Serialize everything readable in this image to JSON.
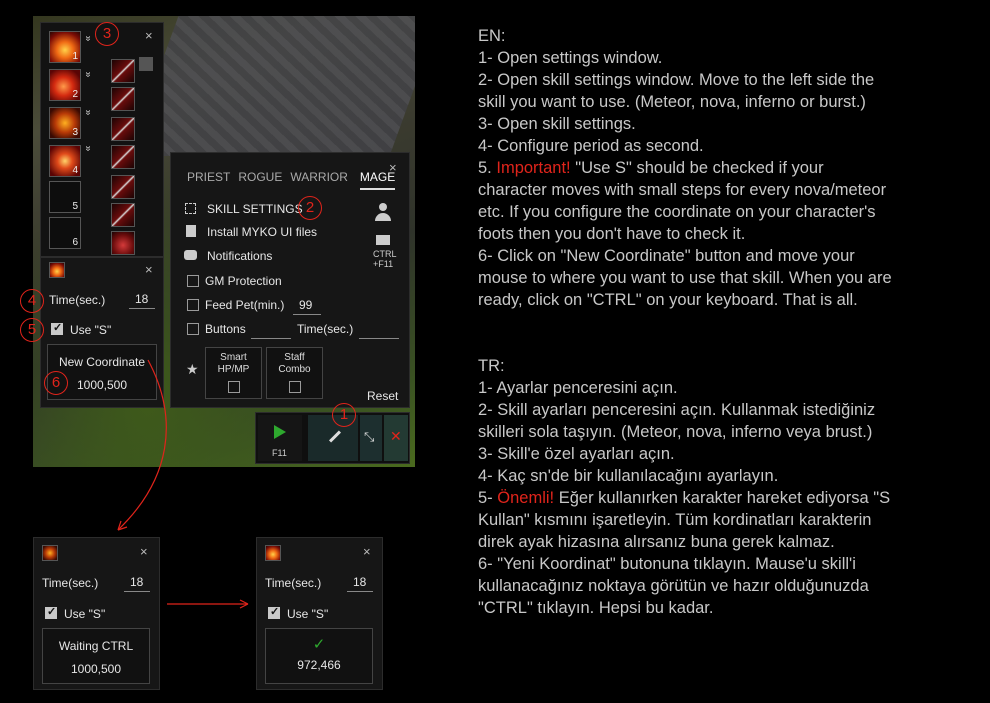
{
  "skillbar": {
    "close_label": "×",
    "slots": [
      {
        "num": "1",
        "icon": "fire-skill-icon"
      },
      {
        "num": "2",
        "icon": "fire-skill-icon"
      },
      {
        "num": "3",
        "icon": "skull-fire-icon"
      },
      {
        "num": "4",
        "icon": "fire-ring-icon"
      },
      {
        "num": "5",
        "icon": ""
      },
      {
        "num": "6",
        "icon": ""
      }
    ],
    "chevron": "»"
  },
  "skill_panel": {
    "close_label": "×",
    "time_label": "Time(sec.)",
    "time_value": "18",
    "use_s_label": "Use \"S\"",
    "coord_button": "New Coordinate",
    "coord_value": "1000,500"
  },
  "settings": {
    "close_label": "×",
    "tabs": [
      "PRIEST",
      "ROGUE",
      "WARRIOR",
      "MAGE"
    ],
    "active_tab": "MAGE",
    "skill_settings": "SKILL SETTINGS",
    "install_ui": "Install MYKO UI files",
    "notifications": "Notifications",
    "gm_protection": "GM Protection",
    "feed_pet": "Feed Pet(min.)",
    "feed_pet_value": "99",
    "buttons": "Buttons",
    "time_sec": "Time(sec.)",
    "ctrl_label": "CTRL",
    "ctrl_key": "+F11",
    "smart": "Smart HP/MP",
    "staff": "Staff Combo",
    "reset": "Reset"
  },
  "toolbar": {
    "play_key": "F11"
  },
  "markers": [
    "1",
    "2",
    "3",
    "4",
    "5",
    "6"
  ],
  "waiting_panel": {
    "close_label": "×",
    "time_label": "Time(sec.)",
    "time_value": "18",
    "use_s_label": "Use \"S\"",
    "button_label": "Waiting CTRL",
    "coord_value": "1000,500"
  },
  "done_panel": {
    "close_label": "×",
    "time_label": "Time(sec.)",
    "time_value": "18",
    "use_s_label": "Use \"S\"",
    "check_mark": "✓",
    "coord_value": "972,466"
  },
  "instructions_en": {
    "heading": "EN:",
    "lines": [
      "1- Open settings window.",
      "2- Open skill settings window. Move to the left side the",
      "skill you want to use. (Meteor, nova, inferno or burst.)",
      "3- Open skill settings.",
      "4- Configure period as second."
    ],
    "important_prefix": "5. ",
    "important_word": "Important!",
    "important_rest": " \"Use S\" should be checked if your",
    "lines2": [
      "character moves with small steps for every nova/meteor",
      "etc. If you configure the coordinate on your character's",
      "foots then you don't have to check it.",
      "6- Click on \"New Coordinate\" button and move your",
      "mouse to where you want to use that skill. When you are",
      "ready, click on \"CTRL\" on your keyboard. That is all."
    ]
  },
  "instructions_tr": {
    "heading": "TR:",
    "lines": [
      "1- Ayarlar penceresini açın.",
      "2- Skill ayarları penceresini açın. Kullanmak istediğiniz",
      "skilleri sola taşıyın. (Meteor, nova, inferno veya brust.)",
      "3- Skill'e özel ayarları açın.",
      "4- Kaç sn'de bir kullanılacağını ayarlayın."
    ],
    "important_prefix": "5- ",
    "important_word": "Önemli!",
    "important_rest": " Eğer kullanırken karakter hareket ediyorsa \"S",
    "lines2": [
      "Kullan\" kısmını işaretleyin. Tüm kordinatları karakterin",
      "direk ayak hizasına alırsanız buna gerek kalmaz.",
      "6- \"Yeni Koordinat\" butonuna tıklayın. Mause'u skill'i",
      "kullanacağınız noktaya görütün ve hazır olduğunuzda",
      "\"CTRL\" tıklayın. Hepsi bu kadar."
    ]
  },
  "colors": {
    "accent_red": "#e0241b",
    "play_green": "#2ea82e"
  }
}
